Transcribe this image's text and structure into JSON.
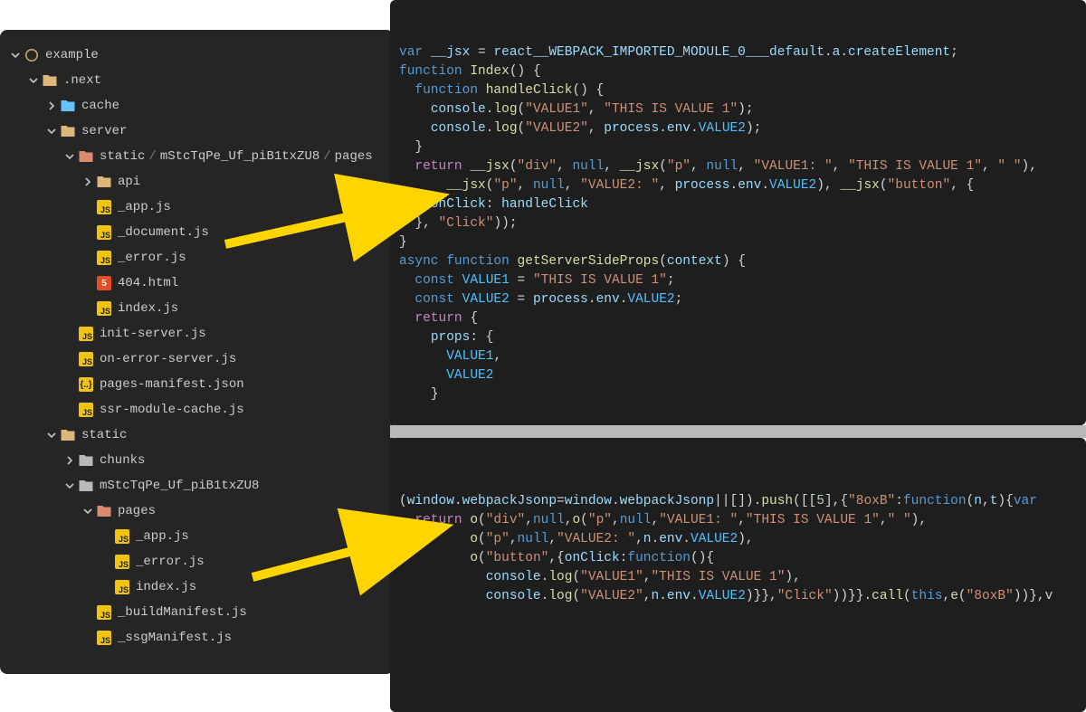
{
  "colors": {
    "sidebar_bg": "#252526",
    "editor_bg": "#1e1e1e",
    "accent_arrow": "#ffd500",
    "js_icon": "#f1c40f",
    "html_icon": "#e44d26",
    "folder_open": "#dcb67a",
    "folder_closed": "#b8b8b8"
  },
  "sidebar": {
    "root": "example",
    "nodes": [
      {
        "type": "folder-open",
        "name": ".next",
        "depth": 1
      },
      {
        "type": "folder-closed",
        "name": "cache",
        "color": "#66c2ff",
        "depth": 2,
        "chev": "right"
      },
      {
        "type": "folder-open",
        "name": "server",
        "depth": 2
      },
      {
        "type": "path-open",
        "name": "static / mStcTqPe_Uf_piB1txZU8 / pages",
        "depth": 3
      },
      {
        "type": "folder-closed",
        "name": "api",
        "color": "#dcb67a",
        "depth": 4,
        "chev": "right"
      },
      {
        "type": "file-js",
        "name": "_app.js",
        "depth": 4
      },
      {
        "type": "file-js",
        "name": "_document.js",
        "depth": 4
      },
      {
        "type": "file-js",
        "name": "_error.js",
        "depth": 4
      },
      {
        "type": "file-html",
        "name": "404.html",
        "depth": 4
      },
      {
        "type": "file-js",
        "name": "index.js",
        "depth": 4
      },
      {
        "type": "file-js",
        "name": "init-server.js",
        "depth": 3
      },
      {
        "type": "file-js",
        "name": "on-error-server.js",
        "depth": 3
      },
      {
        "type": "file-json",
        "name": "pages-manifest.json",
        "depth": 3
      },
      {
        "type": "file-js",
        "name": "ssr-module-cache.js",
        "depth": 3
      },
      {
        "type": "folder-open",
        "name": "static",
        "depth": 2
      },
      {
        "type": "folder-closed",
        "name": "chunks",
        "color": "#b8b8b8",
        "depth": 3,
        "chev": "right"
      },
      {
        "type": "folder-open-grey",
        "name": "mStcTqPe_Uf_piB1txZU8",
        "depth": 3
      },
      {
        "type": "folder-open-red",
        "name": "pages",
        "depth": 4
      },
      {
        "type": "file-js",
        "name": "_app.js",
        "depth": 5
      },
      {
        "type": "file-js",
        "name": "_error.js",
        "depth": 5
      },
      {
        "type": "file-js",
        "name": "index.js",
        "depth": 5
      },
      {
        "type": "file-js",
        "name": "_buildManifest.js",
        "depth": 4
      },
      {
        "type": "file-js",
        "name": "_ssgManifest.js",
        "depth": 4
      }
    ]
  },
  "code_top": {
    "lines": [
      [
        [
          "kw",
          "var"
        ],
        [
          "punc",
          " "
        ],
        [
          "var",
          "__jsx"
        ],
        [
          "punc",
          " = "
        ],
        [
          "var",
          "react__WEBPACK_IMPORTED_MODULE_0___default"
        ],
        [
          "punc",
          "."
        ],
        [
          "var",
          "a"
        ],
        [
          "punc",
          "."
        ],
        [
          "var",
          "createElement"
        ],
        [
          "punc",
          ";"
        ]
      ],
      [
        [
          "kw",
          "function"
        ],
        [
          "punc",
          " "
        ],
        [
          "fn",
          "Index"
        ],
        [
          "punc",
          "() {"
        ]
      ],
      [
        [
          "guide",
          "  "
        ],
        [
          "kw",
          "function"
        ],
        [
          "punc",
          " "
        ],
        [
          "fn",
          "handleClick"
        ],
        [
          "punc",
          "() {"
        ]
      ],
      [
        [
          "guide",
          "    "
        ],
        [
          "var",
          "console"
        ],
        [
          "punc",
          "."
        ],
        [
          "fn",
          "log"
        ],
        [
          "punc",
          "("
        ],
        [
          "str",
          "\"VALUE1\""
        ],
        [
          "punc",
          ", "
        ],
        [
          "str",
          "\"THIS IS VALUE 1\""
        ],
        [
          "punc",
          ");"
        ]
      ],
      [
        [
          "guide",
          "    "
        ],
        [
          "var",
          "console"
        ],
        [
          "punc",
          "."
        ],
        [
          "fn",
          "log"
        ],
        [
          "punc",
          "("
        ],
        [
          "str",
          "\"VALUE2\""
        ],
        [
          "punc",
          ", "
        ],
        [
          "var",
          "process"
        ],
        [
          "punc",
          "."
        ],
        [
          "var",
          "env"
        ],
        [
          "punc",
          "."
        ],
        [
          "obj",
          "VALUE2"
        ],
        [
          "punc",
          ");"
        ]
      ],
      [
        [
          "guide",
          "  "
        ],
        [
          "punc",
          "}"
        ]
      ],
      [
        [
          "punc",
          ""
        ]
      ],
      [
        [
          "guide",
          "  "
        ],
        [
          "kw2",
          "return"
        ],
        [
          "punc",
          " "
        ],
        [
          "fn",
          "__jsx"
        ],
        [
          "punc",
          "("
        ],
        [
          "str",
          "\"div\""
        ],
        [
          "punc",
          ", "
        ],
        [
          "kw",
          "null"
        ],
        [
          "punc",
          ", "
        ],
        [
          "fn",
          "__jsx"
        ],
        [
          "punc",
          "("
        ],
        [
          "str",
          "\"p\""
        ],
        [
          "punc",
          ", "
        ],
        [
          "kw",
          "null"
        ],
        [
          "punc",
          ", "
        ],
        [
          "str",
          "\"VALUE1: \""
        ],
        [
          "punc",
          ", "
        ],
        [
          "str",
          "\"THIS IS VALUE 1\""
        ],
        [
          "punc",
          ", "
        ],
        [
          "str",
          "\" \""
        ],
        [
          "punc",
          "),"
        ]
      ],
      [
        [
          "guide",
          "      "
        ],
        [
          "fn",
          "__jsx"
        ],
        [
          "punc",
          "("
        ],
        [
          "str",
          "\"p\""
        ],
        [
          "punc",
          ", "
        ],
        [
          "kw",
          "null"
        ],
        [
          "punc",
          ", "
        ],
        [
          "str",
          "\"VALUE2: \""
        ],
        [
          "punc",
          ", "
        ],
        [
          "var",
          "process"
        ],
        [
          "punc",
          "."
        ],
        [
          "var",
          "env"
        ],
        [
          "punc",
          "."
        ],
        [
          "obj",
          "VALUE2"
        ],
        [
          "punc",
          "), "
        ],
        [
          "fn",
          "__jsx"
        ],
        [
          "punc",
          "("
        ],
        [
          "str",
          "\"button\""
        ],
        [
          "punc",
          ", {"
        ]
      ],
      [
        [
          "guide",
          "    "
        ],
        [
          "prop",
          "onClick"
        ],
        [
          "punc",
          ": "
        ],
        [
          "var",
          "handleClick"
        ]
      ],
      [
        [
          "guide",
          "  "
        ],
        [
          "punc",
          "}, "
        ],
        [
          "str",
          "\"Click\""
        ],
        [
          "punc",
          "));"
        ]
      ],
      [
        [
          "punc",
          "}"
        ]
      ],
      [
        [
          "kw",
          "async"
        ],
        [
          "punc",
          " "
        ],
        [
          "kw",
          "function"
        ],
        [
          "punc",
          " "
        ],
        [
          "fn",
          "getServerSideProps"
        ],
        [
          "punc",
          "("
        ],
        [
          "var",
          "context"
        ],
        [
          "punc",
          ") {"
        ]
      ],
      [
        [
          "guide",
          "  "
        ],
        [
          "kw",
          "const"
        ],
        [
          "punc",
          " "
        ],
        [
          "obj",
          "VALUE1"
        ],
        [
          "punc",
          " = "
        ],
        [
          "str",
          "\"THIS IS VALUE 1\""
        ],
        [
          "punc",
          ";"
        ]
      ],
      [
        [
          "guide",
          "  "
        ],
        [
          "kw",
          "const"
        ],
        [
          "punc",
          " "
        ],
        [
          "obj",
          "VALUE2"
        ],
        [
          "punc",
          " = "
        ],
        [
          "var",
          "process"
        ],
        [
          "punc",
          "."
        ],
        [
          "var",
          "env"
        ],
        [
          "punc",
          "."
        ],
        [
          "obj",
          "VALUE2"
        ],
        [
          "punc",
          ";"
        ]
      ],
      [
        [
          "guide",
          "  "
        ],
        [
          "kw2",
          "return"
        ],
        [
          "punc",
          " {"
        ]
      ],
      [
        [
          "guide",
          "    "
        ],
        [
          "prop",
          "props"
        ],
        [
          "punc",
          ": {"
        ]
      ],
      [
        [
          "guide",
          "      "
        ],
        [
          "obj",
          "VALUE1"
        ],
        [
          "punc",
          ","
        ]
      ],
      [
        [
          "guide",
          "      "
        ],
        [
          "obj",
          "VALUE2"
        ]
      ],
      [
        [
          "guide",
          "    "
        ],
        [
          "punc",
          "}"
        ]
      ]
    ]
  },
  "code_bot": {
    "lines": [
      [
        [
          "punc",
          "("
        ],
        [
          "var",
          "window"
        ],
        [
          "punc",
          "."
        ],
        [
          "var",
          "webpackJsonp"
        ],
        [
          "punc",
          "="
        ],
        [
          "var",
          "window"
        ],
        [
          "punc",
          "."
        ],
        [
          "var",
          "webpackJsonp"
        ],
        [
          "punc",
          "||[])."
        ],
        [
          "fn",
          "push"
        ],
        [
          "punc",
          "([["
        ],
        [
          "num",
          "5"
        ],
        [
          "punc",
          "],{"
        ],
        [
          "str",
          "\"8oxB\""
        ],
        [
          "punc",
          ":"
        ],
        [
          "kw",
          "function"
        ],
        [
          "punc",
          "("
        ],
        [
          "var",
          "n"
        ],
        [
          "punc",
          ","
        ],
        [
          "var",
          "t"
        ],
        [
          "punc",
          "){"
        ],
        [
          "kw",
          "var"
        ]
      ],
      [
        [
          "punc",
          ""
        ]
      ],
      [
        [
          "guide",
          "  "
        ],
        [
          "kw2",
          "return"
        ],
        [
          "punc",
          " "
        ],
        [
          "fn",
          "o"
        ],
        [
          "punc",
          "("
        ],
        [
          "str",
          "\"div\""
        ],
        [
          "punc",
          ","
        ],
        [
          "kw",
          "null"
        ],
        [
          "punc",
          ","
        ],
        [
          "fn",
          "o"
        ],
        [
          "punc",
          "("
        ],
        [
          "str",
          "\"p\""
        ],
        [
          "punc",
          ","
        ],
        [
          "kw",
          "null"
        ],
        [
          "punc",
          ","
        ],
        [
          "str",
          "\"VALUE1: \""
        ],
        [
          "punc",
          ","
        ],
        [
          "str",
          "\"THIS IS VALUE 1\""
        ],
        [
          "punc",
          ","
        ],
        [
          "str",
          "\" \""
        ],
        [
          "punc",
          "),"
        ]
      ],
      [
        [
          "guide",
          "         "
        ],
        [
          "fn",
          "o"
        ],
        [
          "punc",
          "("
        ],
        [
          "str",
          "\"p\""
        ],
        [
          "punc",
          ","
        ],
        [
          "kw",
          "null"
        ],
        [
          "punc",
          ","
        ],
        [
          "str",
          "\"VALUE2: \""
        ],
        [
          "punc",
          ","
        ],
        [
          "var",
          "n"
        ],
        [
          "punc",
          "."
        ],
        [
          "var",
          "env"
        ],
        [
          "punc",
          "."
        ],
        [
          "obj",
          "VALUE2"
        ],
        [
          "punc",
          "),"
        ]
      ],
      [
        [
          "guide",
          "         "
        ],
        [
          "fn",
          "o"
        ],
        [
          "punc",
          "("
        ],
        [
          "str",
          "\"button\""
        ],
        [
          "punc",
          ",{"
        ],
        [
          "prop",
          "onClick"
        ],
        [
          "punc",
          ":"
        ],
        [
          "kw",
          "function"
        ],
        [
          "punc",
          "(){"
        ]
      ],
      [
        [
          "guide",
          "           "
        ],
        [
          "var",
          "console"
        ],
        [
          "punc",
          "."
        ],
        [
          "fn",
          "log"
        ],
        [
          "punc",
          "("
        ],
        [
          "str",
          "\"VALUE1\""
        ],
        [
          "punc",
          ","
        ],
        [
          "str",
          "\"THIS IS VALUE 1\""
        ],
        [
          "punc",
          "),"
        ]
      ],
      [
        [
          "guide",
          "           "
        ],
        [
          "var",
          "console"
        ],
        [
          "punc",
          "."
        ],
        [
          "fn",
          "log"
        ],
        [
          "punc",
          "("
        ],
        [
          "str",
          "\"VALUE2\""
        ],
        [
          "punc",
          ","
        ],
        [
          "var",
          "n"
        ],
        [
          "punc",
          "."
        ],
        [
          "var",
          "env"
        ],
        [
          "punc",
          "."
        ],
        [
          "obj",
          "VALUE2"
        ],
        [
          "punc",
          ")}},"
        ],
        [
          "str",
          "\"Click\""
        ],
        [
          "punc",
          "))}}."
        ],
        [
          "fn",
          "call"
        ],
        [
          "punc",
          "("
        ],
        [
          "kw",
          "this"
        ],
        [
          "punc",
          ","
        ],
        [
          "fn",
          "e"
        ],
        [
          "punc",
          "("
        ],
        [
          "str",
          "\"8oxB\""
        ],
        [
          "punc",
          "))},v"
        ]
      ]
    ]
  }
}
